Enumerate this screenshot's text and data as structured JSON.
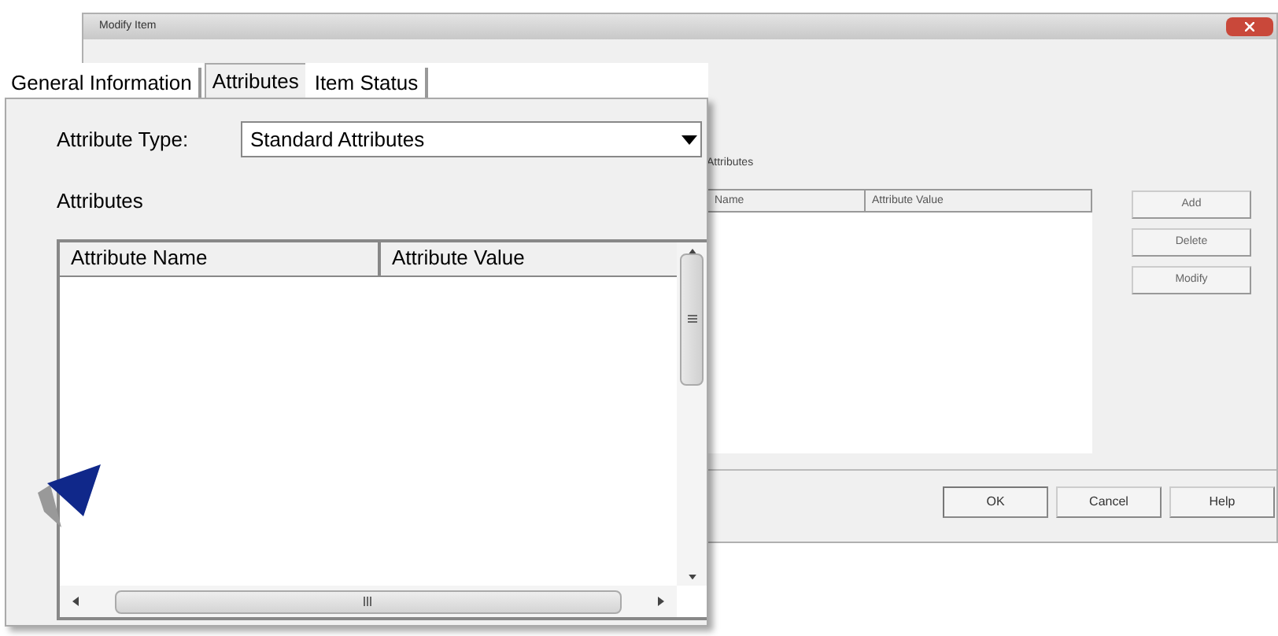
{
  "window": {
    "title": "Modify Item"
  },
  "background_dialog": {
    "section_label": "Attributes",
    "table": {
      "columns": [
        "Name",
        "Attribute Value"
      ]
    },
    "side_buttons": [
      "Add",
      "Delete",
      "Modify"
    ],
    "footer_buttons": [
      "OK",
      "Cancel",
      "Help"
    ]
  },
  "zoomed_view": {
    "tabs": [
      {
        "label": "General Information",
        "selected": false
      },
      {
        "label": "Attributes",
        "selected": true
      },
      {
        "label": "Item Status",
        "selected": false
      }
    ],
    "attribute_type": {
      "label": "Attribute Type:",
      "value": "Standard Attributes"
    },
    "section_label": "Attributes",
    "table": {
      "columns": [
        "Attribute Name",
        "Attribute Value"
      ]
    }
  }
}
